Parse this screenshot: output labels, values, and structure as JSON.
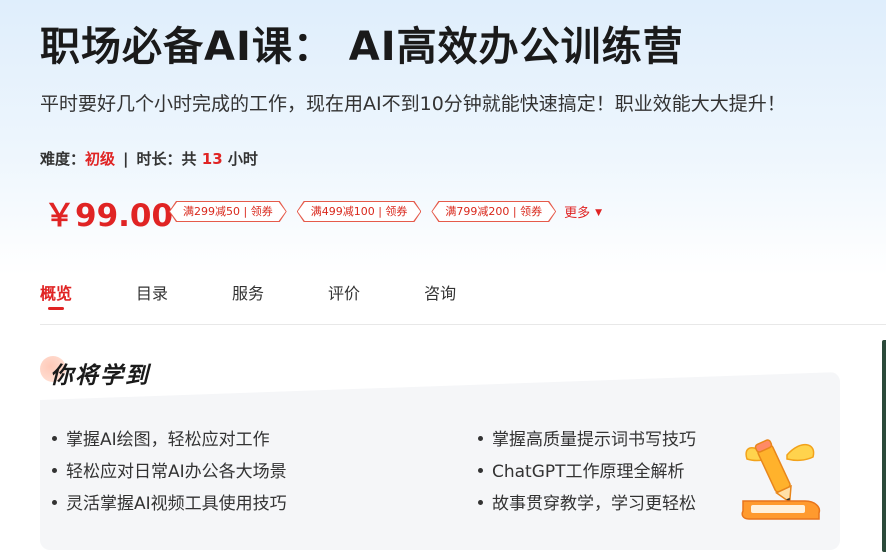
{
  "course": {
    "title": "职场必备AI课：  AI高效办公训练营",
    "subtitle": "平时要好几个小时完成的工作，现在用AI不到10分钟就能快速搞定！职业效能大大提升！",
    "difficulty_label": "难度：",
    "difficulty_value": "初级",
    "separator": "|",
    "duration_label": "时长：共",
    "duration_value": "13",
    "duration_unit": "小时"
  },
  "pricing": {
    "price": "￥99.00",
    "coupons": [
      "满299减50 | 领券",
      "满499减100 | 领券",
      "满799减200 | 领券"
    ],
    "more_label": "更多",
    "accent_color": "#e02424"
  },
  "tabs": [
    {
      "label": "概览",
      "active": true
    },
    {
      "label": "目录",
      "active": false
    },
    {
      "label": "服务",
      "active": false
    },
    {
      "label": "评价",
      "active": false
    },
    {
      "label": "咨询",
      "active": false
    }
  ],
  "learn": {
    "title": "你将学到",
    "left_items": [
      "掌握AI绘图，轻松应对工作",
      "轻松应对日常AI办公各大场景",
      "灵活掌握AI视频工具使用技巧"
    ],
    "right_items": [
      "掌握高质量提示词书写技巧",
      "ChatGPT工作原理全解析",
      "故事贯穿教学，学习更轻松"
    ],
    "illustration_icon": "pencil-book-icon"
  }
}
